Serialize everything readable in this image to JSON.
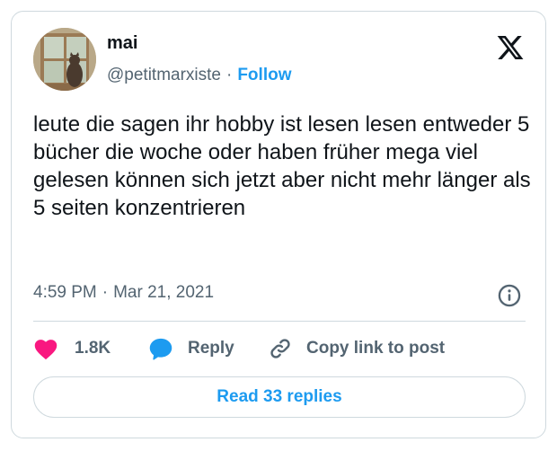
{
  "tweet": {
    "author_name": "mai",
    "author_handle": "@petitmarxiste",
    "separator": "·",
    "follow_label": "Follow",
    "text": "leute die sagen ihr hobby ist lesen lesen entweder 5 bücher die woche oder haben früher mega viel gelesen können sich jetzt aber nicht mehr länger als 5 seiten konzentrieren",
    "time": "4:59 PM",
    "date": "Mar 21, 2021"
  },
  "actions": {
    "like_count": "1.8K",
    "reply_label": "Reply",
    "copy_label": "Copy link to post"
  },
  "read_replies_label": "Read 33 replies",
  "icons": {
    "brand": "x-logo-icon",
    "info": "info-icon",
    "like": "heart-icon",
    "reply": "speech-bubble-icon",
    "copy": "link-icon"
  },
  "colors": {
    "accent": "#1d9bf0",
    "like": "#f91880",
    "text": "#0f1419",
    "muted": "#536471",
    "border": "#cfd9de"
  }
}
